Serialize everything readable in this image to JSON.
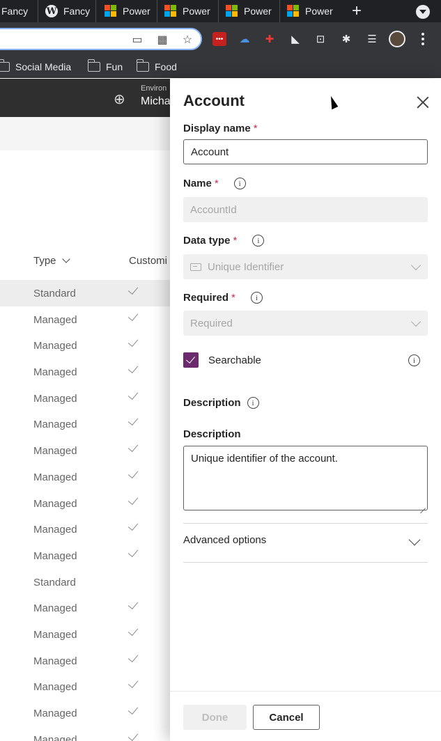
{
  "browser": {
    "tabs": [
      {
        "title": "Fancy",
        "icon": "folder-fav"
      },
      {
        "title": "Fancy",
        "icon": "wordpress-icon"
      },
      {
        "title": "Power",
        "icon": "microsoft-icon"
      },
      {
        "title": "Power",
        "icon": "microsoft-icon"
      },
      {
        "title": "Power",
        "icon": "microsoft-icon"
      },
      {
        "title": "Power",
        "icon": "microsoft-icon"
      }
    ],
    "newtab_label": "+",
    "bookmarks": [
      {
        "label": "Social Media"
      },
      {
        "label": "Fun"
      },
      {
        "label": "Food"
      }
    ]
  },
  "app": {
    "env_label": "Environ",
    "env_name": "Micha",
    "column_type": "Type",
    "column_customizable": "Customi",
    "rows": [
      {
        "type": "Standard",
        "check": true,
        "selected": true
      },
      {
        "type": "Managed",
        "check": true
      },
      {
        "type": "Managed",
        "check": true
      },
      {
        "type": "Managed",
        "check": true
      },
      {
        "type": "Managed",
        "check": true
      },
      {
        "type": "Managed",
        "check": true
      },
      {
        "type": "Managed",
        "check": true
      },
      {
        "type": "Managed",
        "check": true
      },
      {
        "type": "Managed",
        "check": true
      },
      {
        "type": "Managed",
        "check": true
      },
      {
        "type": "Managed",
        "check": true
      },
      {
        "type": "Standard",
        "check": false
      },
      {
        "type": "Managed",
        "check": true
      },
      {
        "type": "Managed",
        "check": true
      },
      {
        "type": "Managed",
        "check": true
      },
      {
        "type": "Managed",
        "check": true
      },
      {
        "type": "Managed",
        "check": true
      },
      {
        "type": "Managed",
        "check": true
      }
    ]
  },
  "panel": {
    "title": "Account",
    "display_name_label": "Display name",
    "display_name_value": "Account",
    "name_label": "Name",
    "name_value": "AccountId",
    "data_type_label": "Data type",
    "data_type_value": "Unique Identifier",
    "required_label": "Required",
    "required_value": "Required",
    "searchable_label": "Searchable",
    "description_section_label": "Description",
    "description_label": "Description",
    "description_value": "Unique identifier of the account.",
    "advanced_label": "Advanced options",
    "done_label": "Done",
    "cancel_label": "Cancel",
    "required_mark": "*",
    "info_glyph": "i"
  },
  "colors": {
    "accent": "#6b2a6b",
    "required": "#c4314b",
    "header": "#2f2f2f"
  }
}
